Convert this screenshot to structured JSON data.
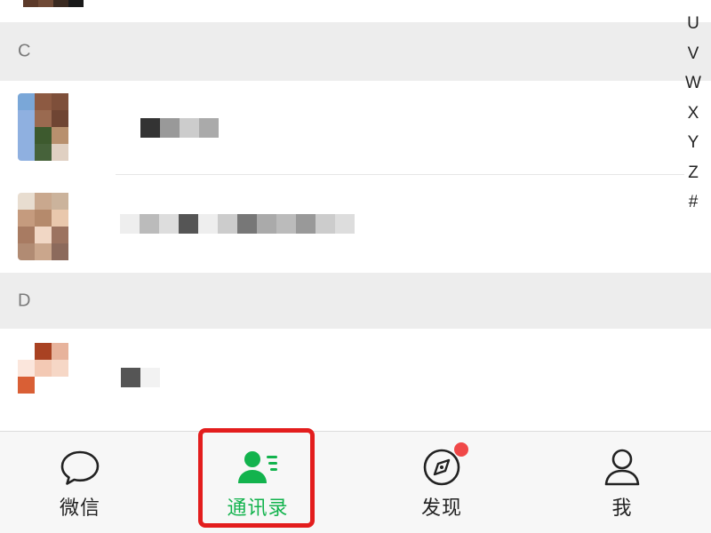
{
  "alpha_index": [
    "U",
    "V",
    "W",
    "X",
    "Y",
    "Z",
    "#"
  ],
  "sections": [
    {
      "letter": "C"
    },
    {
      "letter": "D"
    }
  ],
  "tabbar": {
    "tabs": [
      {
        "label": "微信",
        "icon": "chat-bubble-icon",
        "active": false
      },
      {
        "label": "通讯录",
        "icon": "contacts-icon",
        "active": true
      },
      {
        "label": "发现",
        "icon": "compass-icon",
        "active": false,
        "badge_dot": true
      },
      {
        "label": "我",
        "icon": "person-icon",
        "active": false
      }
    ]
  },
  "colors": {
    "accent": "#12b34d",
    "highlight": "#e31d1d",
    "badge": "#f04848",
    "section_bg": "#ededed"
  }
}
